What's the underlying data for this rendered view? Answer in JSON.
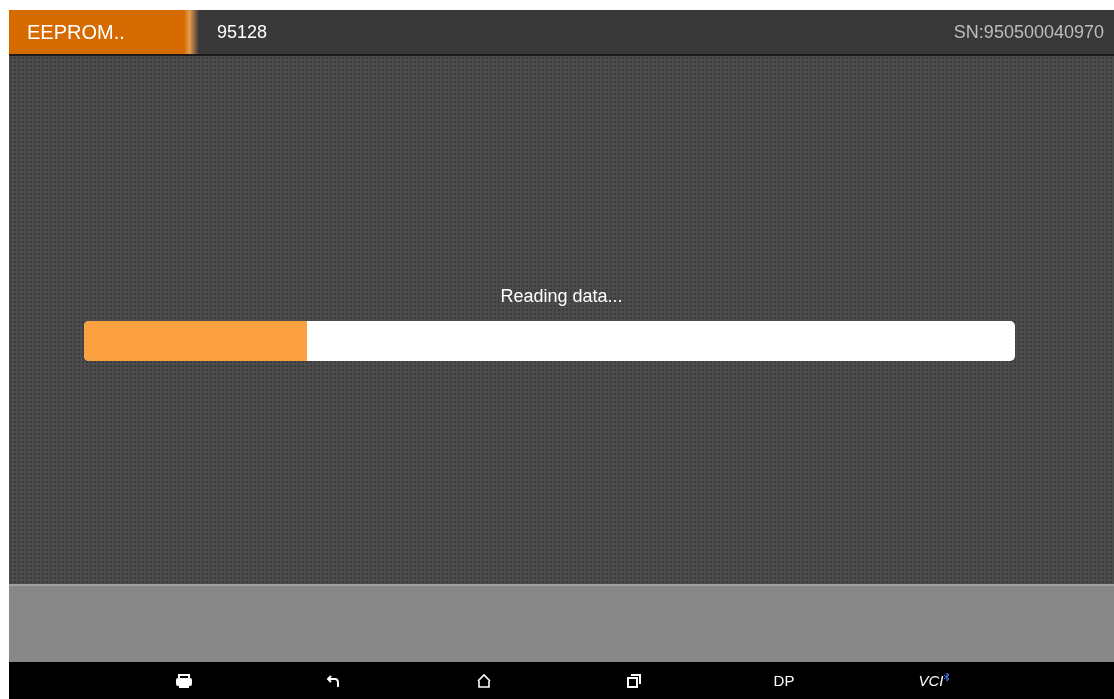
{
  "header": {
    "title": "EEPROM..",
    "subtitle": "95128",
    "serial": "SN:950500040970"
  },
  "progress": {
    "message": "Reading data...",
    "level": 0.24
  },
  "nav_bar": {
    "items": [
      {
        "kind": "print"
      },
      {
        "kind": "back"
      },
      {
        "kind": "home"
      },
      {
        "kind": "recent"
      },
      {
        "kind": "text",
        "label": "DP"
      },
      {
        "kind": "vci",
        "label": "VCI"
      }
    ]
  }
}
